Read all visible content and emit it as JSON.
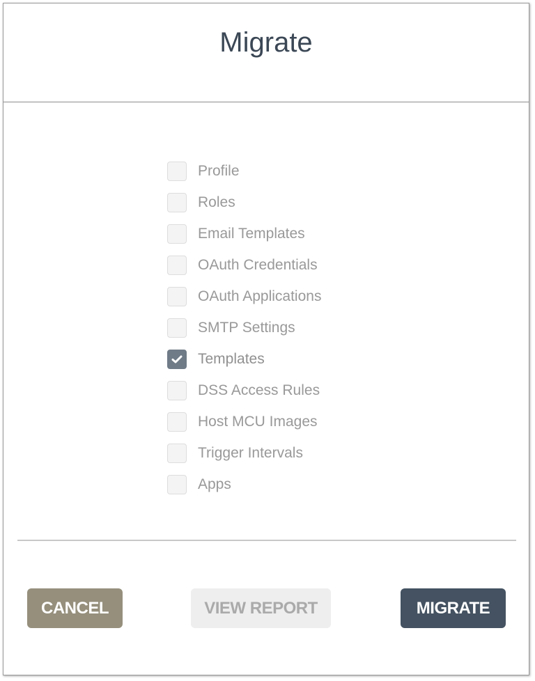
{
  "dialog": {
    "title": "Migrate"
  },
  "options": [
    {
      "label": "Profile",
      "checked": false
    },
    {
      "label": "Roles",
      "checked": false
    },
    {
      "label": "Email Templates",
      "checked": false
    },
    {
      "label": "OAuth Credentials",
      "checked": false
    },
    {
      "label": "OAuth Applications",
      "checked": false
    },
    {
      "label": "SMTP Settings",
      "checked": false
    },
    {
      "label": "Templates",
      "checked": true
    },
    {
      "label": "DSS Access Rules",
      "checked": false
    },
    {
      "label": "Host MCU Images",
      "checked": false
    },
    {
      "label": "Trigger Intervals",
      "checked": false
    },
    {
      "label": "Apps",
      "checked": false
    }
  ],
  "buttons": {
    "cancel_label": "CANCEL",
    "view_report_label": "VIEW REPORT",
    "migrate_label": "MIGRATE"
  },
  "colors": {
    "title": "#3b4755",
    "checkbox_checked": "#6f7b87",
    "cancel_button": "#958f7c",
    "view_report_button": "#eeeeee",
    "migrate_button": "#445261"
  }
}
